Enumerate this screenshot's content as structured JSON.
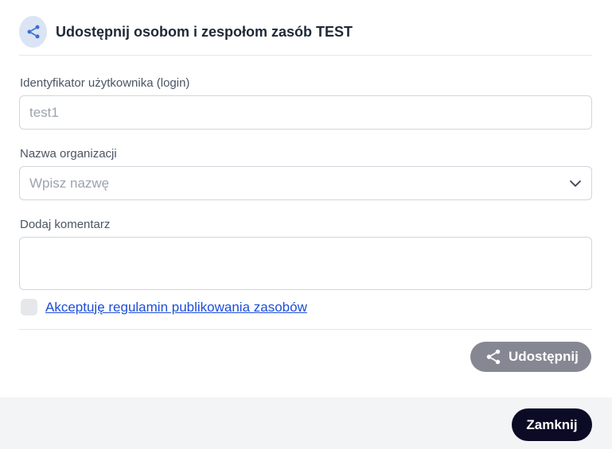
{
  "dialog": {
    "title": "Udostępnij osobom i zespołom zasób TEST"
  },
  "form": {
    "login_label": "Identyfikator użytkownika (login)",
    "login_value": "test1",
    "org_label": "Nazwa organizacji",
    "org_placeholder": "Wpisz nazwę",
    "comment_label": "Dodaj komentarz",
    "comment_value": "",
    "terms_checked": false,
    "terms_label": "Akceptuję regulamin publikowania zasobów"
  },
  "actions": {
    "share_label": "Udostępnij",
    "close_label": "Zamknij"
  },
  "icons": {
    "header": "share-icon",
    "share_button": "share-icon",
    "org_select": "chevron-down-icon"
  },
  "colors": {
    "icon_bg": "#dbe4f5",
    "icon_fg": "#3b6fd4",
    "share_button_bg": "#858893",
    "close_button_bg": "#0b0b26",
    "link": "#1d4ed8",
    "footer_bg": "#f3f4f6"
  }
}
